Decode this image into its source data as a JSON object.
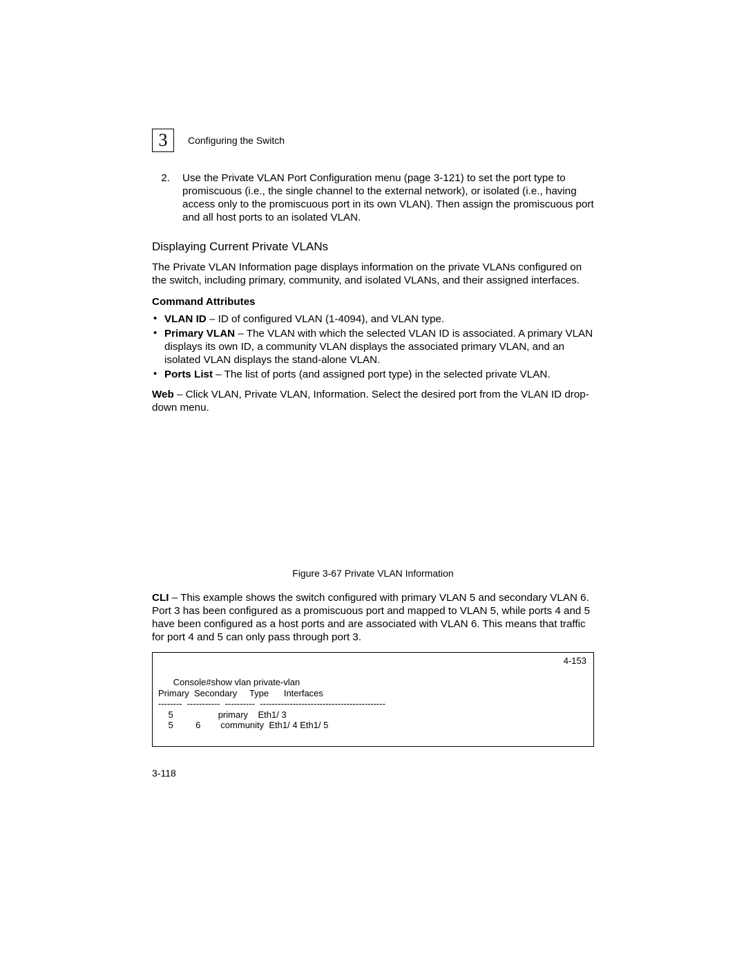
{
  "header": {
    "chapter_number": "3",
    "running_head": "Configuring the Switch"
  },
  "step2": {
    "marker": "2.",
    "text": "Use the Private VLAN Port Configuration menu (page 3-121) to set the port type to promiscuous (i.e., the single channel to the external network), or isolated (i.e., having access only to the promiscuous port in its own VLAN). Then assign the promiscuous port and all host ports to an isolated VLAN."
  },
  "section": {
    "title": "Displaying Current Private VLANs",
    "intro": "The Private VLAN Information page displays information on the private VLANs configured on the switch, including primary, community, and isolated VLANs, and their assigned interfaces."
  },
  "command_attributes": {
    "heading": "Command Attributes",
    "items": [
      {
        "term": "VLAN ID",
        "desc": " – ID of configured VLAN (1-4094), and VLAN type."
      },
      {
        "term": "Primary VLAN",
        "desc": " – The VLAN with which the selected VLAN ID is associated. A primary VLAN displays its own ID, a community VLAN displays the associated primary VLAN, and an isolated VLAN displays the stand-alone VLAN."
      },
      {
        "term": "Ports List",
        "desc": " – The list of ports (and assigned port type) in the selected private VLAN."
      }
    ]
  },
  "web_note": {
    "label": "Web",
    "text": " – Click VLAN, Private VLAN, Information. Select the desired port from the VLAN ID drop-down menu."
  },
  "figure_caption": "Figure 3-67  Private VLAN Information",
  "cli_note": {
    "label": "CLI",
    "text": " – This example shows the switch configured with primary VLAN 5 and secondary VLAN 6. Port 3 has been configured as a promiscuous port and mapped to VLAN 5, while ports 4 and 5 have been configured as a host ports and are associated with VLAN 6. This means that traffic for port 4 and 5 can only pass through port 3."
  },
  "cli_output": {
    "ref": "4-153",
    "text": "Console#show vlan private-vlan\nPrimary  Secondary     Type      Interfaces\n--------  -----------  ----------  ------------------------------------------\n    5                  primary    Eth1/ 3\n    5         6        community  Eth1/ 4 Eth1/ 5"
  },
  "page_number": "3-118"
}
